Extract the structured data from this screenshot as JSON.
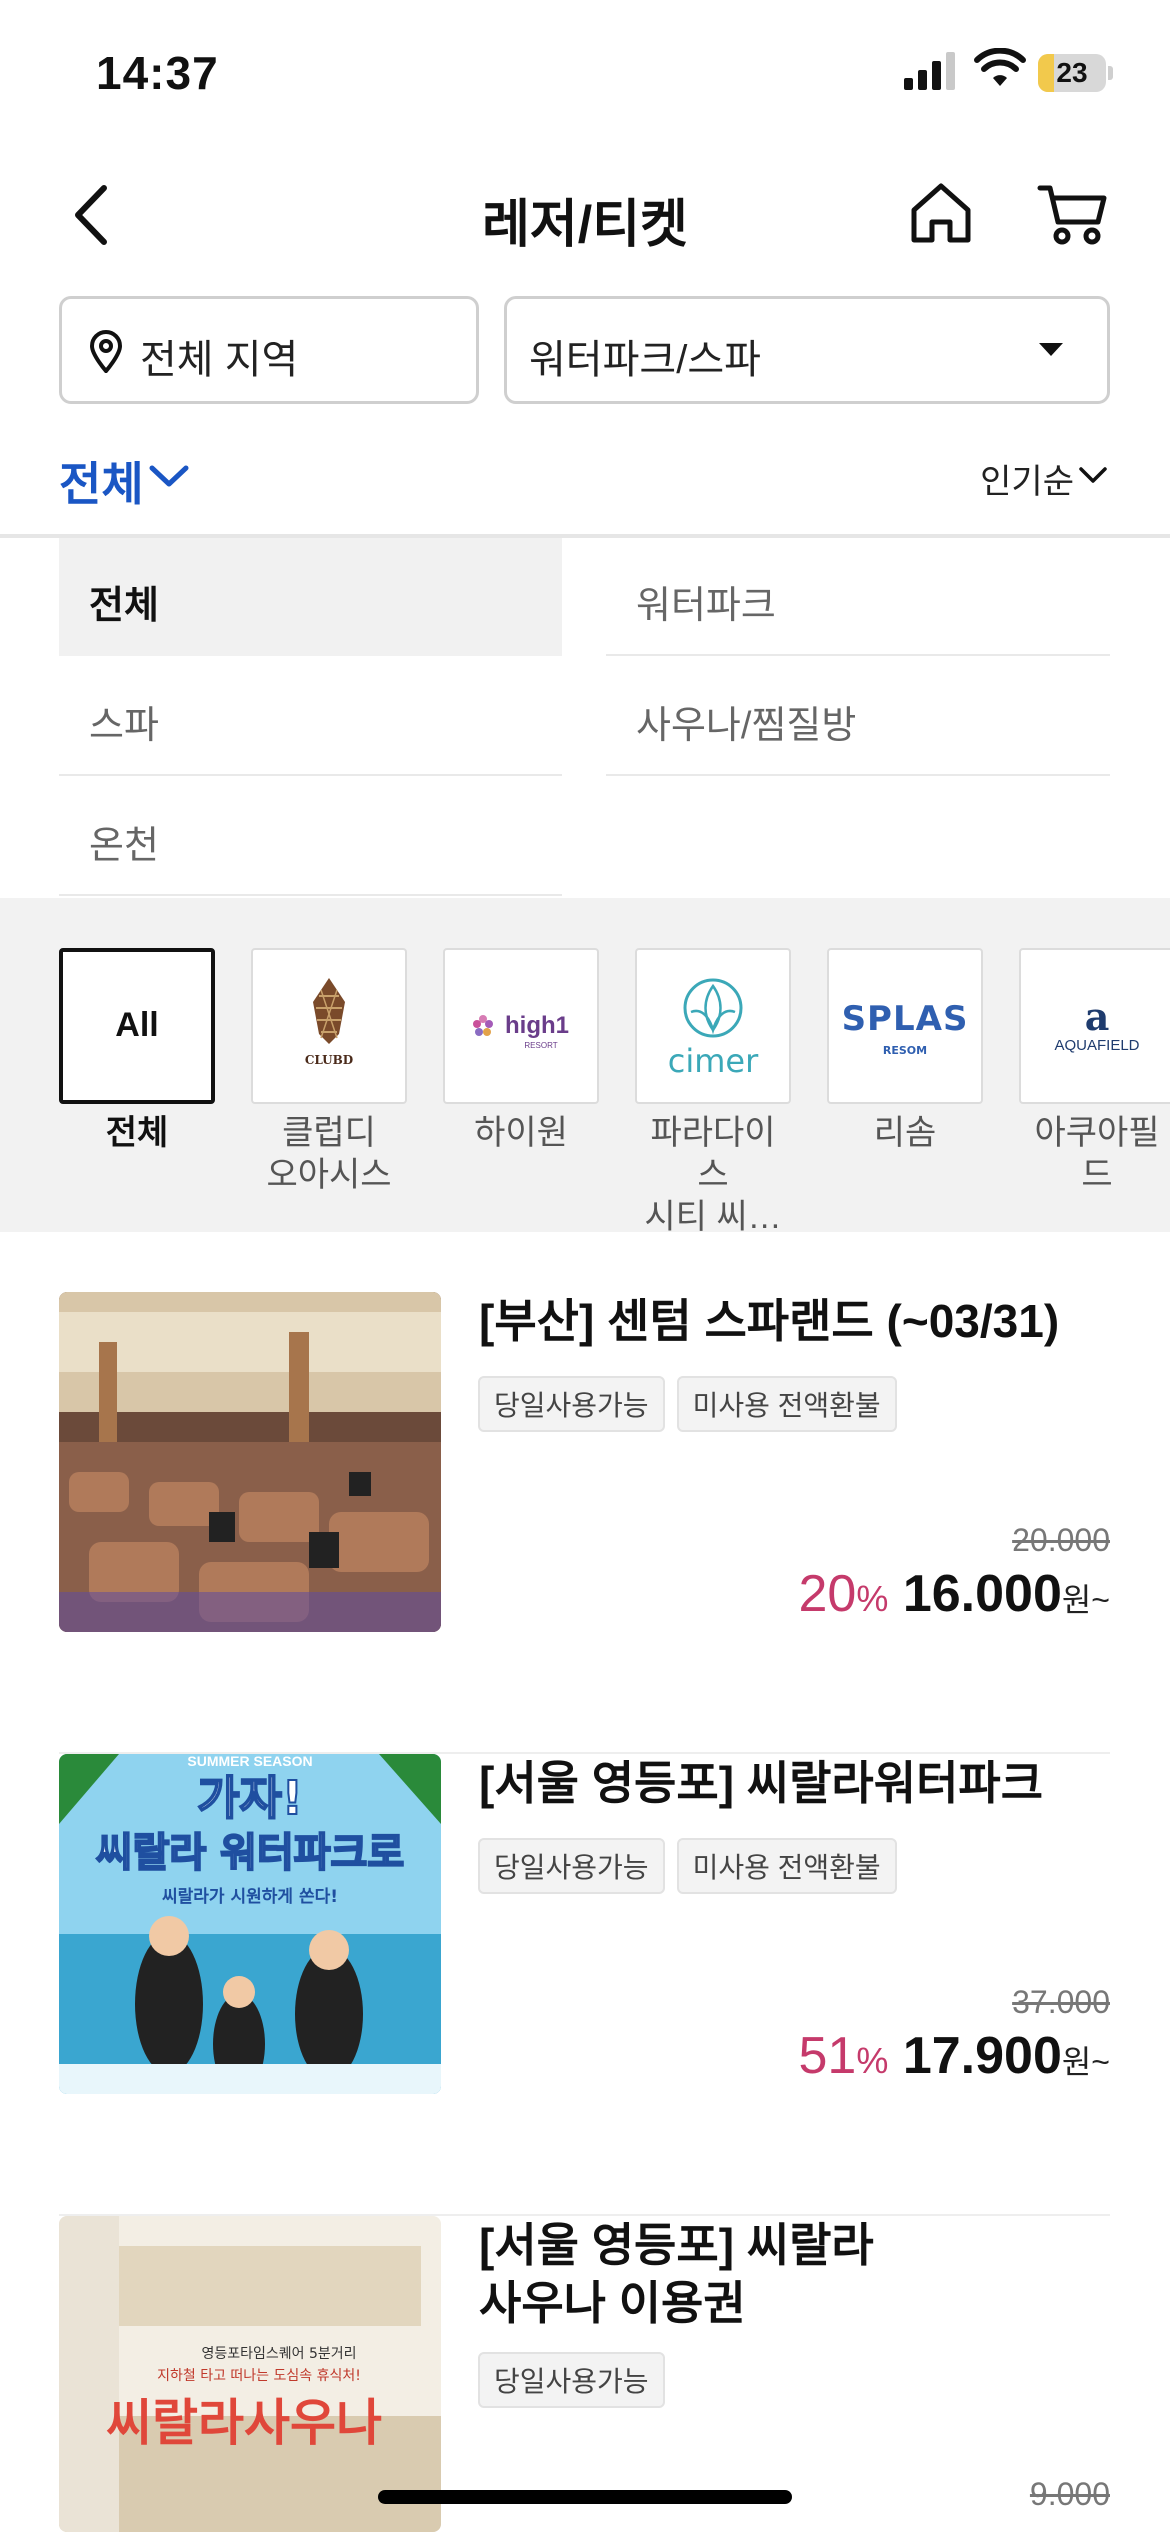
{
  "status_bar": {
    "time": "14:37",
    "battery": "23",
    "battery_level": 0.23
  },
  "header": {
    "title": "레저/티켓"
  },
  "filters": {
    "region": "전체 지역",
    "category": "워터파크/스파"
  },
  "sort_row": {
    "category_filter": "전체",
    "sort": "인기순"
  },
  "subcategories": [
    {
      "label": "전체",
      "active": true
    },
    {
      "label": "워터파크"
    },
    {
      "label": "스파"
    },
    {
      "label": "사우나/찜질방"
    },
    {
      "label": "온천"
    }
  ],
  "brands": [
    {
      "label": "전체",
      "box_text": "All",
      "icon": "all"
    },
    {
      "label": "클럽디\n오아시스",
      "icon": "clubd-logo",
      "logo_text": "CLUBD"
    },
    {
      "label": "하이원",
      "icon": "high1-logo",
      "logo_text": "high1",
      "logo_sub": "RESORT"
    },
    {
      "label": "파라다이스\n시티 씨…",
      "icon": "cimer-logo",
      "logo_text": "cimer"
    },
    {
      "label": "리솜",
      "icon": "splas-logo",
      "logo_text": "SPLAS",
      "logo_sub": "RESOM"
    },
    {
      "label": "아쿠아필드",
      "icon": "aquafield-logo",
      "logo_text": "AQUAFIELD",
      "logo_mark": "a"
    }
  ],
  "products": [
    {
      "title": "[부산] 센텀 스파랜드 (~03/31)",
      "tags": [
        "당일사용가능",
        "미사용 전액환불"
      ],
      "original_price": "20.000",
      "discount": "20",
      "price": "16.000",
      "currency": "원~"
    },
    {
      "title": "[서울 영등포] 씨랄라워터파크",
      "tags": [
        "당일사용가능",
        "미사용 전액환불"
      ],
      "original_price": "37.000",
      "discount": "51",
      "price": "17.900",
      "currency": "원~",
      "image_text": {
        "season": "SUMMER SEASON",
        "headline1": "가자!",
        "headline2": "씨랄라 워터파크로",
        "sub": "씨랄라가 시원하게 쏜다!"
      }
    },
    {
      "title": "[서울 영등포] 씨랄라\n사우나 이용권",
      "tags": [
        "당일사용가능"
      ],
      "original_price": "9.000",
      "image_text": {
        "line1": "영등포타임스퀘어 5분거리",
        "line2": "지하철 타고 떠나는 도심속 휴식처!",
        "brand": "씨랄라사우나"
      }
    }
  ],
  "colors": {
    "accent_blue": "#1a56c4",
    "discount_pink": "#c53a6b"
  }
}
